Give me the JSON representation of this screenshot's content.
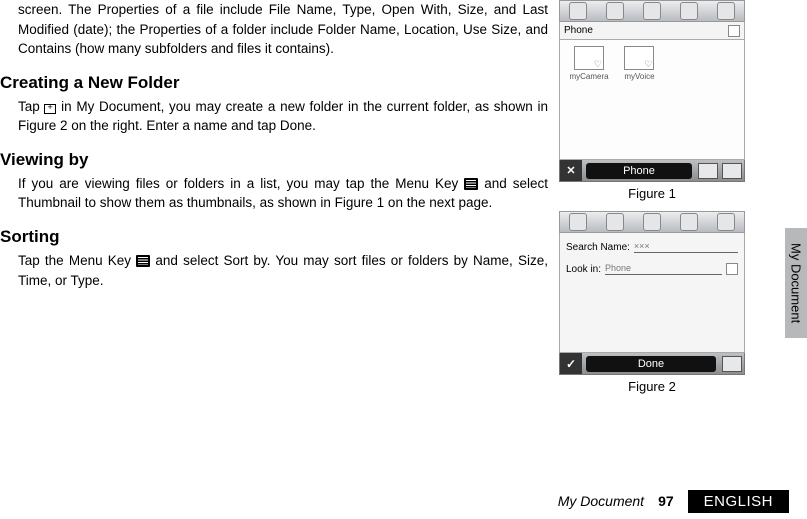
{
  "body": {
    "intro_para": "screen. The Properties of a file include File Name, Type, Open With, Size, and Last Modified (date); the Properties of a folder include Folder Name, Location, Use Size, and Contains (how many subfolders and files it contains).",
    "heading_create": "Creating a New Folder",
    "create_para_a": "Tap ",
    "create_para_b": " in My Document, you may create a new folder in the current fold­er, as shown in Figure 2 on the right. Enter a name and tap Done.",
    "heading_viewing": "Viewing by",
    "viewing_para_a": "If you are viewing files or folders in a list, you may tap the Menu Key ",
    "viewing_para_b": " and select Thumbnail to show them as thumbnails, as shown in Figure 1 on the next page.",
    "heading_sorting": "Sorting",
    "sorting_para_a": "Tap the Menu Key ",
    "sorting_para_b": " and select Sort by. You may sort files or folders by Name, Size, Time, or Type."
  },
  "fig1": {
    "caption": "Figure 1",
    "location": "Phone",
    "folders": [
      "myCamera",
      "myVoice"
    ],
    "bottom_label": "Phone",
    "close_glyph": "✕"
  },
  "fig2": {
    "caption": "Figure 2",
    "search_name_label": "Search Name:",
    "search_name_value": "×××",
    "lookin_label": "Look in:",
    "lookin_value": " Phone",
    "bottom_label": "Done",
    "check_glyph": "✓"
  },
  "side_tab": "My Document",
  "footer": {
    "section": "My Document",
    "page": "97",
    "lang": "ENGLISH"
  }
}
